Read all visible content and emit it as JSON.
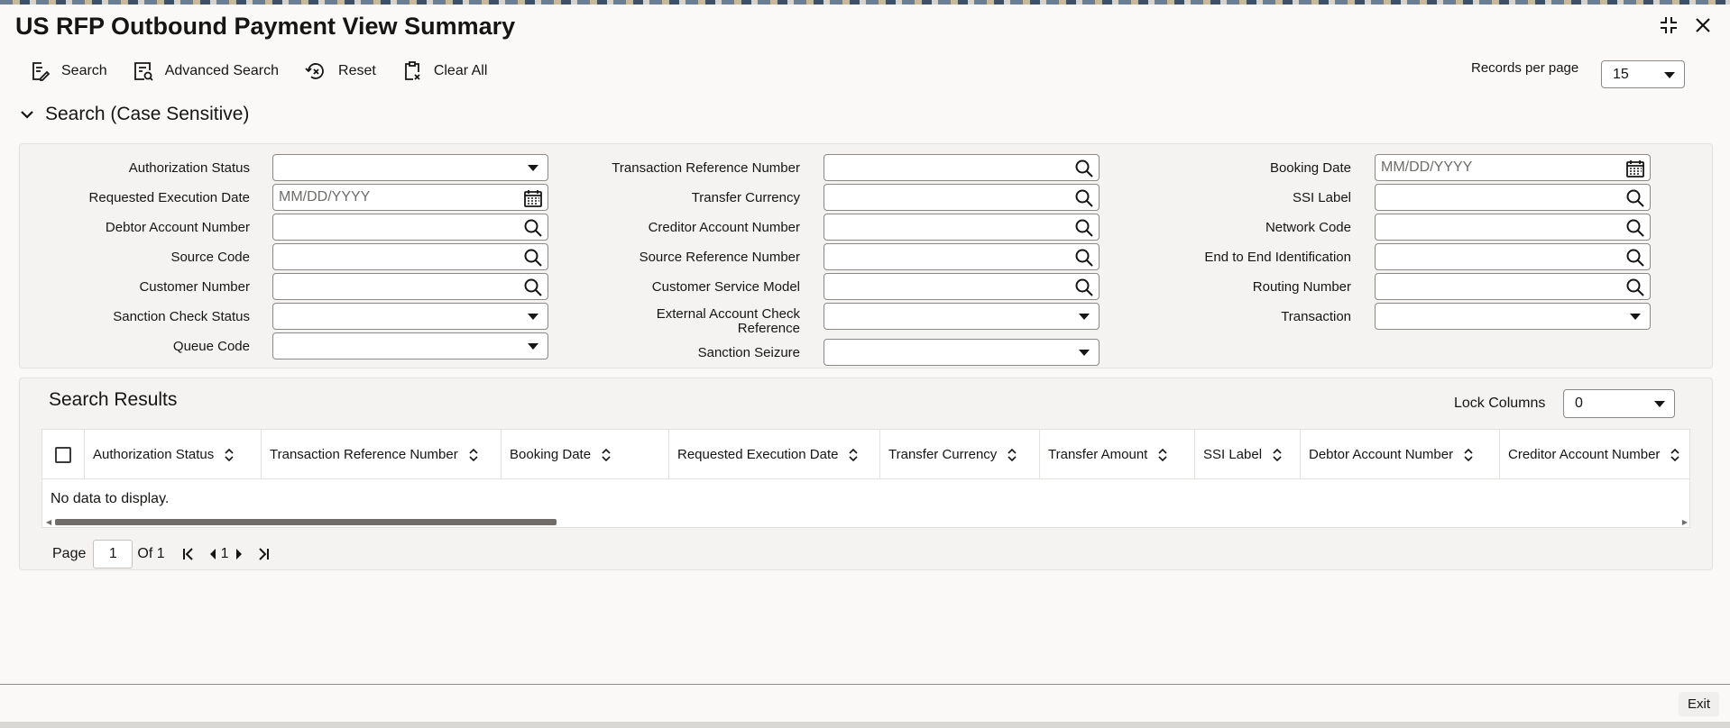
{
  "window": {
    "title": "US RFP Outbound Payment View Summary"
  },
  "toolbar": {
    "search": "Search",
    "advanced_search": "Advanced Search",
    "reset": "Reset",
    "clear_all": "Clear All",
    "records_per_page_label": "Records per page",
    "records_per_page_value": "15"
  },
  "search_section": {
    "title": "Search (Case Sensitive)",
    "fields": {
      "authorization_status": {
        "label": "Authorization Status",
        "value": ""
      },
      "requested_execution_date": {
        "label": "Requested Execution Date",
        "placeholder": "MM/DD/YYYY"
      },
      "debtor_account_number": {
        "label": "Debtor Account Number",
        "value": ""
      },
      "source_code": {
        "label": "Source Code",
        "value": ""
      },
      "customer_number": {
        "label": "Customer Number",
        "value": ""
      },
      "sanction_check_status": {
        "label": "Sanction Check Status",
        "value": ""
      },
      "queue_code": {
        "label": "Queue Code",
        "value": ""
      },
      "transaction_reference_number": {
        "label": "Transaction Reference Number",
        "value": ""
      },
      "transfer_currency": {
        "label": "Transfer Currency",
        "value": ""
      },
      "creditor_account_number": {
        "label": "Creditor Account Number",
        "value": ""
      },
      "source_reference_number": {
        "label": "Source Reference Number",
        "value": ""
      },
      "customer_service_model": {
        "label": "Customer Service Model",
        "value": ""
      },
      "external_account_check_reference": {
        "label_line1": "External Account Check",
        "label_line2": "Reference",
        "value": ""
      },
      "sanction_seizure": {
        "label": "Sanction Seizure",
        "value": ""
      },
      "booking_date": {
        "label": "Booking Date",
        "placeholder": "MM/DD/YYYY"
      },
      "ssi_label": {
        "label": "SSI Label",
        "value": ""
      },
      "network_code": {
        "label": "Network Code",
        "value": ""
      },
      "end_to_end_identification": {
        "label": "End to End Identification",
        "value": ""
      },
      "routing_number": {
        "label": "Routing Number",
        "value": ""
      },
      "transaction": {
        "label": "Transaction",
        "value": ""
      }
    }
  },
  "results": {
    "title": "Search Results",
    "lock_columns_label": "Lock Columns",
    "lock_columns_value": "0",
    "columns": [
      "Authorization Status",
      "Transaction Reference Number",
      "Booking Date",
      "Requested Execution Date",
      "Transfer Currency",
      "Transfer Amount",
      "SSI Label",
      "Debtor Account Number",
      "Creditor Account Number"
    ],
    "no_data": "No data to display.",
    "pager": {
      "page_label": "Page",
      "page_value": "1",
      "of_label": "Of 1",
      "current": "1"
    }
  },
  "footer": {
    "exit": "Exit"
  },
  "colors": {
    "text": "#161513",
    "panel": "#f5f3f1",
    "border": "#8b8985"
  }
}
